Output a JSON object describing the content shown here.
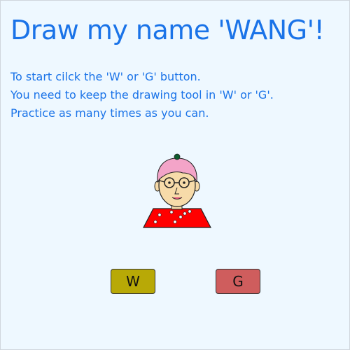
{
  "title": "Draw my name 'WANG'!",
  "instructions": [
    "To start cilck the 'W' or 'G' button.",
    "You need to keep the drawing tool in 'W' or 'G'.",
    "Practice as many times as you can."
  ],
  "buttons": {
    "w_label": "W",
    "g_label": "G"
  },
  "colors": {
    "background": "#eef8ff",
    "text": "#1a73e8",
    "w_button": "#b8a906",
    "g_button": "#cf5d5d",
    "hair": "#f3a4c8",
    "face": "#f7dba9",
    "shirt": "#ff0000"
  },
  "avatar": {
    "icon": "character-avatar-icon"
  }
}
